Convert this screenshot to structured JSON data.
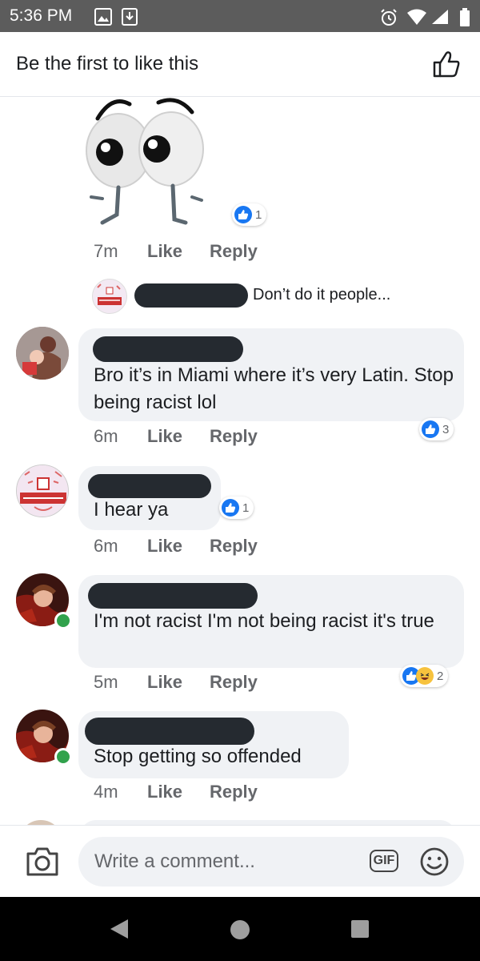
{
  "status_bar": {
    "time": "5:36 PM"
  },
  "header": {
    "title": "Be the first to like this"
  },
  "comments": [
    {
      "time": "7m",
      "like": "Like",
      "reply": "Reply",
      "reaction_count": "1"
    },
    {
      "text": "Don’t do it people..."
    },
    {
      "text": "Bro it’s in Miami where it’s very Latin. Stop being racist lol",
      "time": "6m",
      "like": "Like",
      "reply": "Reply",
      "reaction_count": "3"
    },
    {
      "text": "I hear ya",
      "time": "6m",
      "like": "Like",
      "reply": "Reply",
      "reaction_count": "1"
    },
    {
      "text": "I'm not racist I'm not being racist it's true",
      "time": "5m",
      "like": "Like",
      "reply": "Reply",
      "reaction_count": "2"
    },
    {
      "text": "Stop getting so offended",
      "time": "4m",
      "like": "Like",
      "reply": "Reply"
    }
  ],
  "composer": {
    "placeholder": "Write a comment...",
    "gif_label": "GIF"
  },
  "colors": {
    "accent": "#1877f2",
    "bubble": "#f0f2f5",
    "muted": "#65676b",
    "online": "#31a24c"
  },
  "icons": [
    "image-icon",
    "download-icon",
    "alarm-icon",
    "wifi-icon",
    "signal-icon",
    "battery-icon",
    "thumbs-up-icon",
    "camera-icon",
    "gif-icon",
    "emoji-icon",
    "back-icon",
    "home-icon",
    "recents-icon"
  ]
}
